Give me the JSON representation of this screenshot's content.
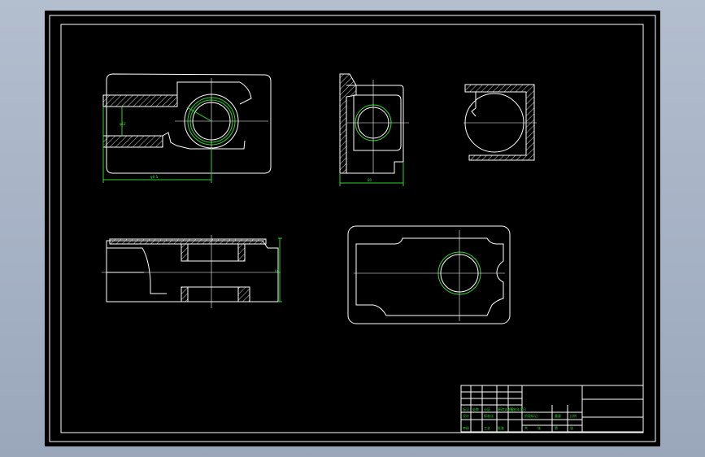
{
  "dimensions": {
    "front_width": "φ8.5",
    "front_height": "φ12",
    "side_width": "80",
    "section_height": "60"
  },
  "title_block": {
    "row1": [
      "标记",
      "处数",
      "分区",
      "更改文件号",
      "签名",
      "年月日"
    ],
    "row2": [
      "设计",
      "标准化",
      "阶段标记",
      "重量",
      "比例"
    ],
    "row3": [
      "审核",
      "工艺",
      "批准",
      "共",
      "张",
      "第",
      "张"
    ]
  },
  "colors": {
    "background": "#000000",
    "geometry": "#ffffff",
    "dimension": "#2bd42b",
    "viewport_border": "#a7b3c6"
  }
}
